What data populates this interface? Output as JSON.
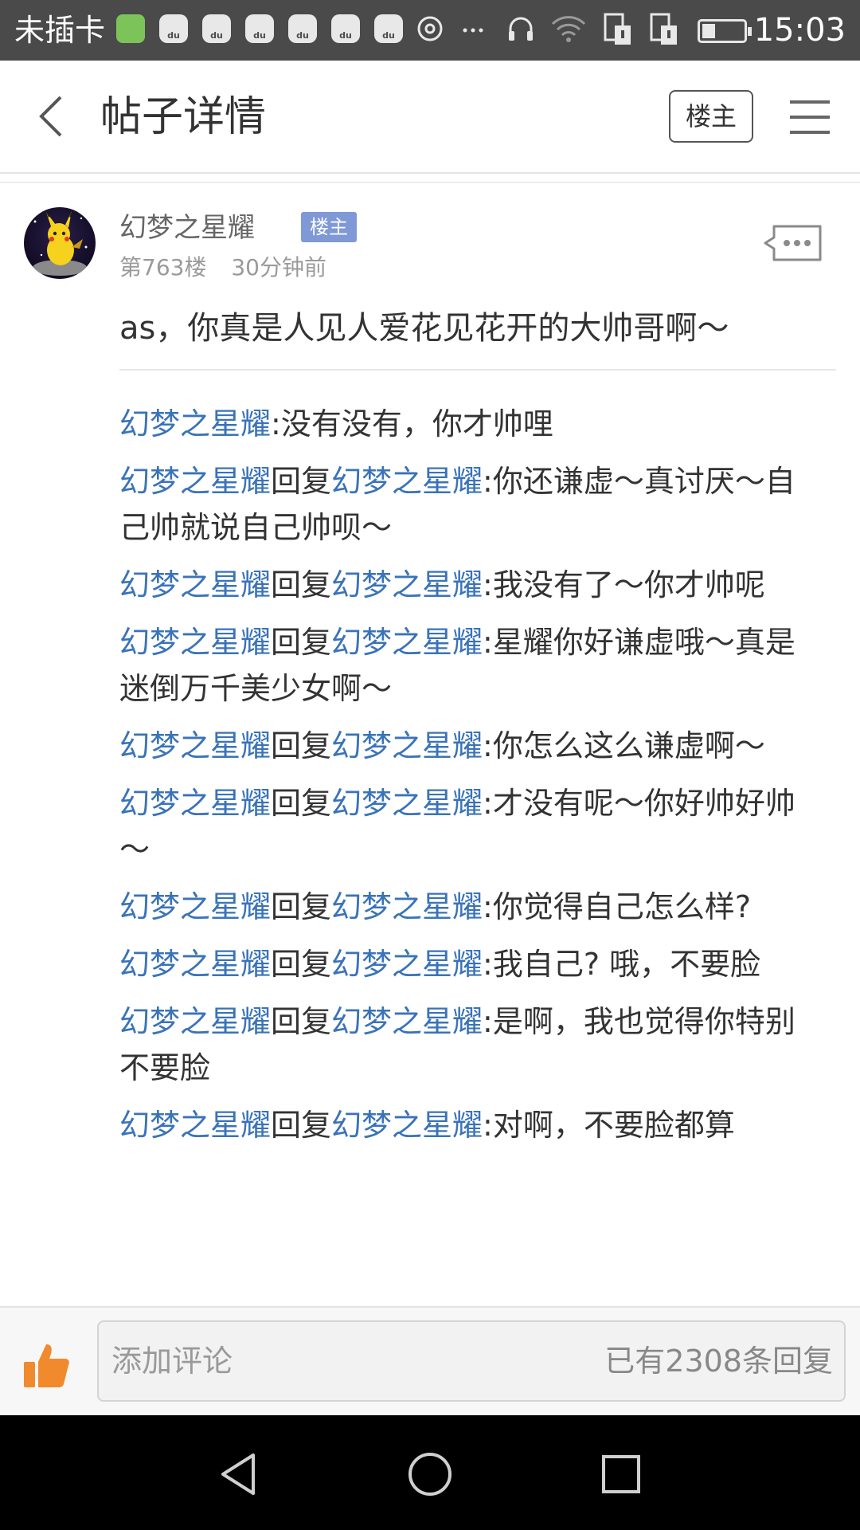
{
  "status_bar": {
    "carrier": "未插卡",
    "time": "15:03",
    "icons": [
      "game-icon",
      "baidu-icon",
      "baidu-icon",
      "baidu-icon",
      "baidu-icon",
      "baidu-icon",
      "baidu-icon",
      "settings-icon",
      "more-icon",
      "headphone-icon",
      "wifi-icon",
      "sim-icon",
      "sim-icon",
      "battery-icon"
    ]
  },
  "header": {
    "title": "帖子详情",
    "louzhu_button": "楼主",
    "back_icon": "chevron-left-icon",
    "menu_icon": "hamburger-menu-icon"
  },
  "post": {
    "author": "幻梦之星耀",
    "badge": "楼主",
    "floor": "第763楼",
    "time": "30分钟前",
    "content": "as，你真是人见人爱花见花开的大帅哥啊～"
  },
  "replies": [
    {
      "from": "幻梦之星耀",
      "reply_word": "",
      "to": "",
      "sep": ":",
      "text": "没有没有，你才帅哩"
    },
    {
      "from": "幻梦之星耀",
      "reply_word": "回复",
      "to": "幻梦之星耀",
      "sep": ":",
      "text": "你还谦虚～真讨厌～自己帅就说自己帅呗～"
    },
    {
      "from": "幻梦之星耀",
      "reply_word": "回复",
      "to": "幻梦之星耀",
      "sep": ":",
      "text": "我没有了～你才帅呢"
    },
    {
      "from": "幻梦之星耀",
      "reply_word": "回复",
      "to": "幻梦之星耀",
      "sep": ":",
      "text": "星耀你好谦虚哦～真是迷倒万千美少女啊～"
    },
    {
      "from": "幻梦之星耀",
      "reply_word": "回复",
      "to": "幻梦之星耀",
      "sep": ":",
      "text": "你怎么这么谦虚啊～"
    },
    {
      "from": "幻梦之星耀",
      "reply_word": "回复",
      "to": "幻梦之星耀",
      "sep": ":",
      "text": "才没有呢～你好帅好帅～"
    },
    {
      "from": "幻梦之星耀",
      "reply_word": "回复",
      "to": "幻梦之星耀",
      "sep": ":",
      "text": "你觉得自己怎么样?"
    },
    {
      "from": "幻梦之星耀",
      "reply_word": "回复",
      "to": "幻梦之星耀",
      "sep": ":",
      "text": "我自己? 哦，不要脸"
    },
    {
      "from": "幻梦之星耀",
      "reply_word": "回复",
      "to": "幻梦之星耀",
      "sep": ":",
      "text": "是啊，我也觉得你特别不要脸"
    },
    {
      "from": "幻梦之星耀",
      "reply_word": "回复",
      "to": "幻梦之星耀",
      "sep": ":",
      "text": "对啊，不要脸都算"
    }
  ],
  "bottom_bar": {
    "placeholder": "添加评论",
    "reply_count": "已有2308条回复",
    "like_icon": "thumbs-up-icon"
  },
  "nav_bar": {
    "icons": [
      "back-triangle-icon",
      "home-circle-icon",
      "recents-square-icon"
    ]
  },
  "colors": {
    "status_bar_bg": "#4a4a4a",
    "link_blue": "#3a73b8",
    "badge_bg": "#7f98d6",
    "like_orange": "#f08a2c"
  }
}
